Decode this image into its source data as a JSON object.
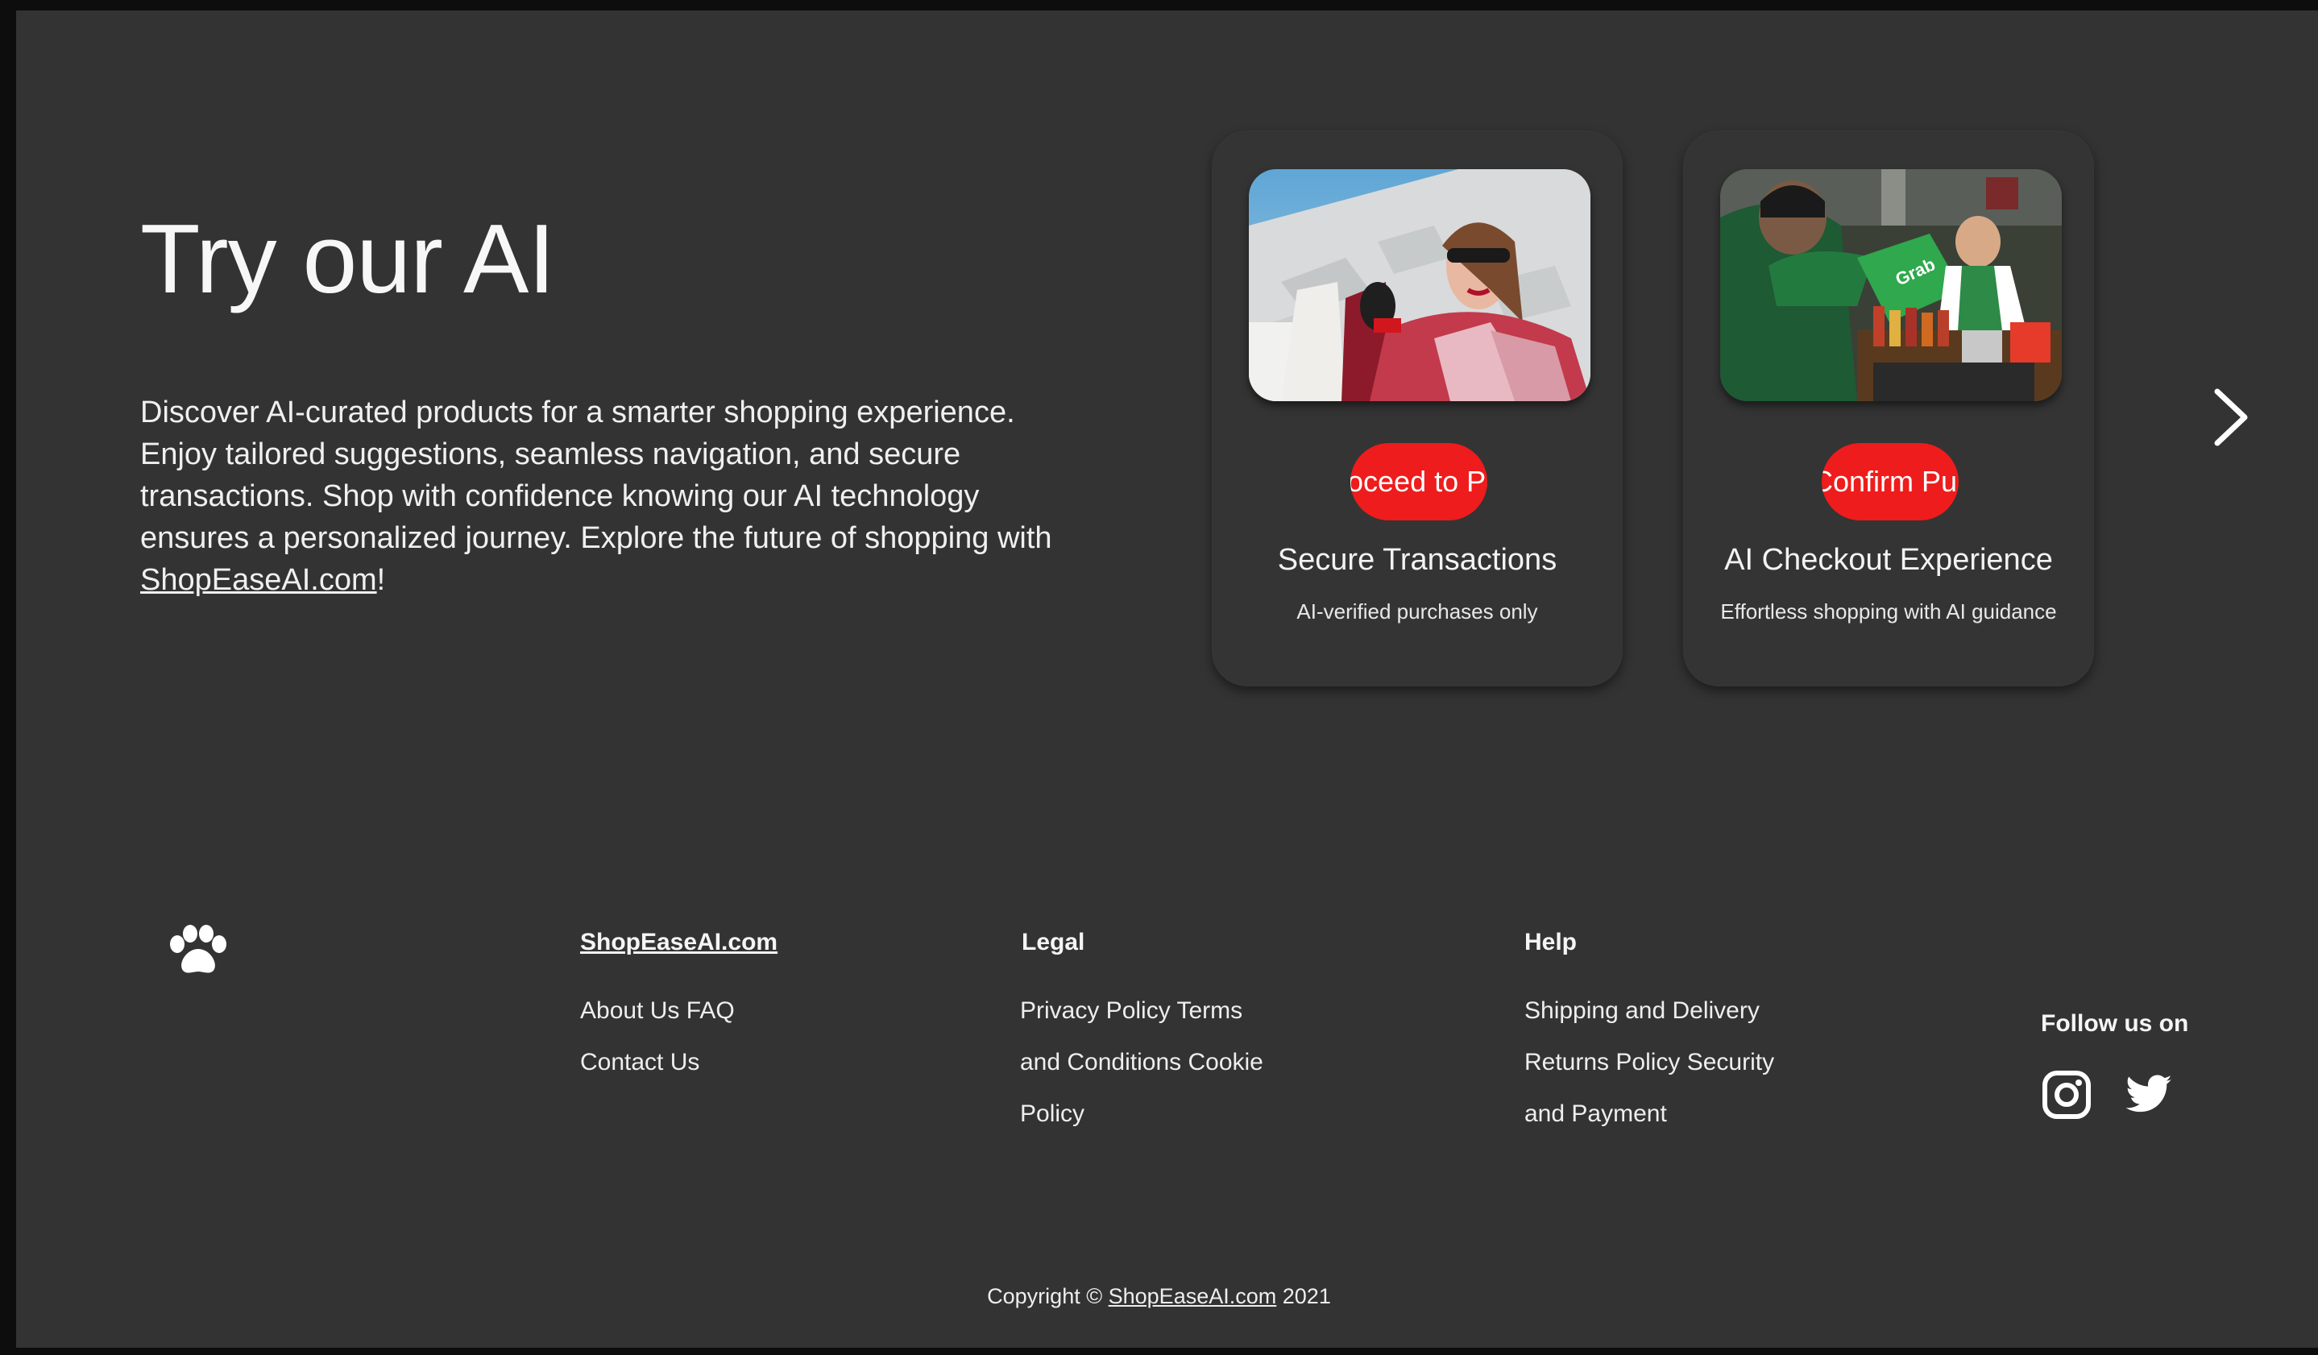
{
  "hero": {
    "title": "Try our AI",
    "description_text": "Discover AI-curated products for a smarter shopping experience. Enjoy tailored suggestions, seamless navigation, and secure transactions. Shop with confidence knowing our AI technology ensures a personalized journey. Explore the future of shopping with ",
    "description_link": "ShopEaseAI.com",
    "description_end": "!"
  },
  "carousel": {
    "cards": [
      {
        "button_label": "Proceed to Payment",
        "title": "Secure Transactions",
        "subtitle": "AI-verified purchases only",
        "image_icon": "woman-with-shopping-bags-photo"
      },
      {
        "button_label": "Confirm Purchase",
        "title": "AI Checkout Experience",
        "subtitle": "Effortless shopping with AI guidance",
        "image_icon": "market-delivery-photo"
      }
    ],
    "next_icon": "chevron-right-icon"
  },
  "footer": {
    "logo_icon": "paw-icon",
    "col1": {
      "heading": "ShopEaseAI.com",
      "links": [
        "About Us FAQ",
        "Contact Us"
      ]
    },
    "col2": {
      "heading": "Legal",
      "links": [
        "Privacy Policy Terms",
        "and Conditions Cookie",
        "Policy"
      ]
    },
    "col3": {
      "heading": "Help",
      "links": [
        "Shipping and Delivery",
        "Returns Policy Security",
        "and Payment"
      ]
    },
    "follow_label": "Follow us on",
    "social_icons": [
      "instagram-icon",
      "twitter-icon"
    ],
    "copyright_prefix": "Copyright ©",
    "copyright_link": "ShopEaseAI.com",
    "copyright_year": "2021"
  },
  "colors": {
    "background": "#333333",
    "outer": "#0d0d0d",
    "accent_button": "#ee1c1c",
    "text": "#f2f2f2"
  }
}
